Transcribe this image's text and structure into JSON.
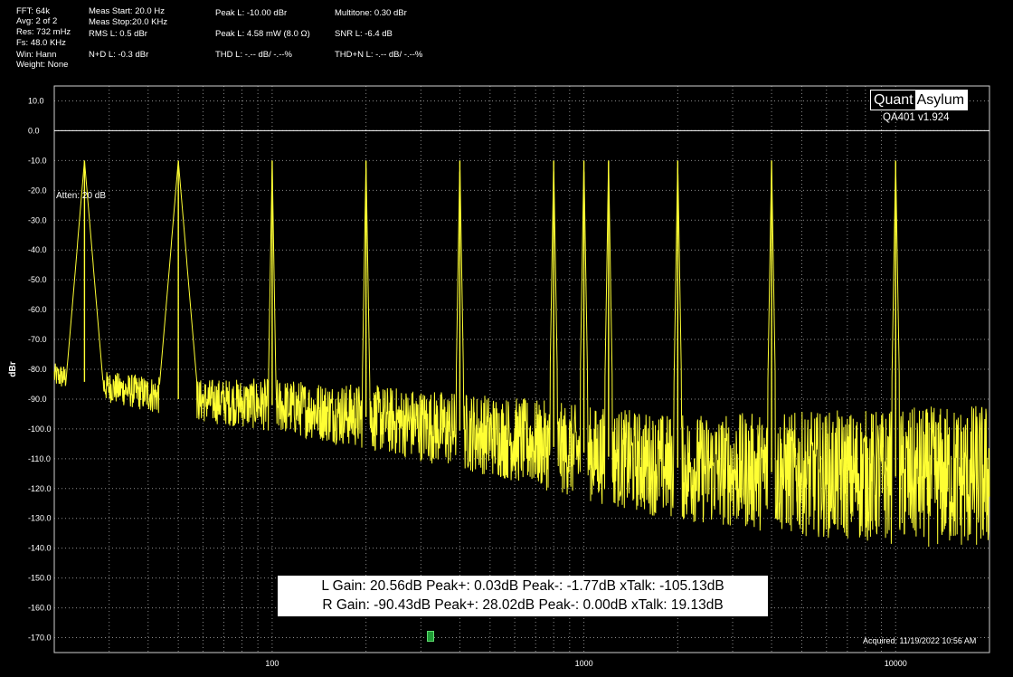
{
  "stats": {
    "fft": "FFT: 64k",
    "avg": "Avg: 2 of 2",
    "res": "Res: 732 mHz",
    "fs": "Fs: 48.0 KHz",
    "win": "Win: Hann",
    "weight": "Weight: None",
    "meas_start": "Meas Start: 20.0 Hz",
    "meas_stop": "Meas Stop:20.0 KHz",
    "rms_l": "RMS L: 0.5 dBr",
    "nd_l": "N+D L: -0.3 dBr",
    "peak_l_dbr": "Peak L: -10.00 dBr",
    "peak_l_mw": "Peak L: 4.58 mW (8.0 Ω)",
    "thd_l": "THD L: -.-- dB/ -.--%",
    "multitone": "Multitone: 0.30  dBr",
    "snr_l": "SNR L: -6.4 dB",
    "thdn_l": "THD+N L: -.-- dB/ -.--%"
  },
  "branding": {
    "logo_left": "Quant",
    "logo_right": "Asylum",
    "version": "QA401 v1.924"
  },
  "annotations": {
    "atten": "Atten: 20 dB",
    "acquired": "Acquired: 11/19/2022  10:56 AM"
  },
  "gain_box": {
    "line1": "L Gain: 20.56dB  Peak+: 0.03dB  Peak-: -1.77dB  xTalk: -105.13dB",
    "line2": "R Gain: -90.43dB  Peak+: 28.02dB  Peak-: 0.00dB  xTalk: 19.13dB"
  },
  "chart_data": {
    "type": "line",
    "title": "",
    "xlabel": "",
    "ylabel": "dBr",
    "xscale": "log",
    "xlim": [
      20,
      20000
    ],
    "ylim": [
      -175,
      15
    ],
    "x_tick_labels": [
      {
        "value": 100,
        "label": "100"
      },
      {
        "value": 1000,
        "label": "1000"
      },
      {
        "value": 10000,
        "label": "10000"
      }
    ],
    "y_ticks": [
      10,
      0,
      -10,
      -20,
      -30,
      -40,
      -50,
      -60,
      -70,
      -80,
      -90,
      -100,
      -110,
      -120,
      -130,
      -140,
      -150,
      -160,
      -170
    ],
    "y_tick_labels": [
      "10.0",
      "0.0",
      "-10.0",
      "-20.0",
      "-30.0",
      "-40.0",
      "-50.0",
      "-60.0",
      "-70.0",
      "-80.0",
      "-90.0",
      "-100.0",
      "-110.0",
      "-120.0",
      "-130.0",
      "-140.0",
      "-150.0",
      "-160.0",
      "-170.0"
    ],
    "reference_line": 0,
    "grid": true,
    "series": [
      {
        "color": "#ffff33",
        "peaks": [
          {
            "freq": 25,
            "dbr": -10
          },
          {
            "freq": 50,
            "dbr": -10
          },
          {
            "freq": 100,
            "dbr": -10
          },
          {
            "freq": 200,
            "dbr": -10
          },
          {
            "freq": 400,
            "dbr": -10
          },
          {
            "freq": 800,
            "dbr": -10
          },
          {
            "freq": 1000,
            "dbr": -10
          },
          {
            "freq": 1200,
            "dbr": -10
          },
          {
            "freq": 2000,
            "dbr": -10
          },
          {
            "freq": 4000,
            "dbr": -10
          },
          {
            "freq": 10000,
            "dbr": -10
          }
        ],
        "noise_floor": [
          {
            "freq": 20,
            "dbr": -82
          },
          {
            "freq": 30,
            "dbr": -86
          },
          {
            "freq": 50,
            "dbr": -90
          },
          {
            "freq": 100,
            "dbr": -92
          },
          {
            "freq": 200,
            "dbr": -96
          },
          {
            "freq": 500,
            "dbr": -102
          },
          {
            "freq": 1000,
            "dbr": -108
          },
          {
            "freq": 2000,
            "dbr": -113
          },
          {
            "freq": 5000,
            "dbr": -115
          },
          {
            "freq": 10000,
            "dbr": -116
          },
          {
            "freq": 20000,
            "dbr": -116
          }
        ]
      }
    ]
  }
}
